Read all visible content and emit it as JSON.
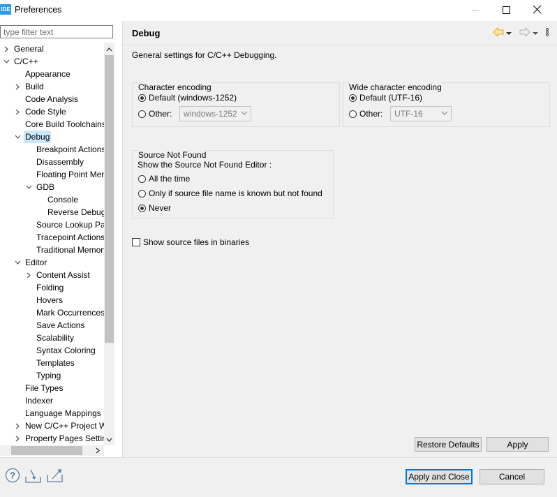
{
  "window": {
    "app_icon": "IDE",
    "title": "Preferences"
  },
  "filter": {
    "placeholder": "type filter text"
  },
  "tree": [
    {
      "label": "General",
      "level": 0,
      "chevron": "right",
      "selected": false
    },
    {
      "label": "C/C++",
      "level": 0,
      "chevron": "down",
      "selected": false
    },
    {
      "label": "Appearance",
      "level": 1,
      "chevron": "none",
      "selected": false
    },
    {
      "label": "Build",
      "level": 1,
      "chevron": "right",
      "selected": false
    },
    {
      "label": "Code Analysis",
      "level": 1,
      "chevron": "none",
      "selected": false
    },
    {
      "label": "Code Style",
      "level": 1,
      "chevron": "right",
      "selected": false
    },
    {
      "label": "Core Build Toolchains",
      "level": 1,
      "chevron": "none",
      "selected": false
    },
    {
      "label": "Debug",
      "level": 1,
      "chevron": "down",
      "selected": true
    },
    {
      "label": "Breakpoint Actions",
      "level": 2,
      "chevron": "none",
      "selected": false
    },
    {
      "label": "Disassembly",
      "level": 2,
      "chevron": "none",
      "selected": false
    },
    {
      "label": "Floating Point Memory",
      "level": 2,
      "chevron": "none",
      "selected": false
    },
    {
      "label": "GDB",
      "level": 2,
      "chevron": "down",
      "selected": false
    },
    {
      "label": "Console",
      "level": 3,
      "chevron": "none",
      "selected": false
    },
    {
      "label": "Reverse Debugging",
      "level": 3,
      "chevron": "none",
      "selected": false
    },
    {
      "label": "Source Lookup Path",
      "level": 2,
      "chevron": "none",
      "selected": false
    },
    {
      "label": "Tracepoint Actions",
      "level": 2,
      "chevron": "none",
      "selected": false
    },
    {
      "label": "Traditional Memory",
      "level": 2,
      "chevron": "none",
      "selected": false
    },
    {
      "label": "Editor",
      "level": 1,
      "chevron": "down",
      "selected": false
    },
    {
      "label": "Content Assist",
      "level": 2,
      "chevron": "right",
      "selected": false
    },
    {
      "label": "Folding",
      "level": 2,
      "chevron": "none",
      "selected": false
    },
    {
      "label": "Hovers",
      "level": 2,
      "chevron": "none",
      "selected": false
    },
    {
      "label": "Mark Occurrences",
      "level": 2,
      "chevron": "none",
      "selected": false
    },
    {
      "label": "Save Actions",
      "level": 2,
      "chevron": "none",
      "selected": false
    },
    {
      "label": "Scalability",
      "level": 2,
      "chevron": "none",
      "selected": false
    },
    {
      "label": "Syntax Coloring",
      "level": 2,
      "chevron": "none",
      "selected": false
    },
    {
      "label": "Templates",
      "level": 2,
      "chevron": "none",
      "selected": false
    },
    {
      "label": "Typing",
      "level": 2,
      "chevron": "none",
      "selected": false
    },
    {
      "label": "File Types",
      "level": 1,
      "chevron": "none",
      "selected": false
    },
    {
      "label": "Indexer",
      "level": 1,
      "chevron": "none",
      "selected": false
    },
    {
      "label": "Language Mappings",
      "level": 1,
      "chevron": "none",
      "selected": false
    },
    {
      "label": "New C/C++ Project Wizard",
      "level": 1,
      "chevron": "right",
      "selected": false
    },
    {
      "label": "Property Pages Settings",
      "level": 1,
      "chevron": "right",
      "selected": false
    }
  ],
  "page": {
    "title": "Debug",
    "description": "General settings for C/C++ Debugging.",
    "char_encoding": {
      "label": "Character encoding",
      "default_label": "Default (windows-1252)",
      "other_label": "Other:",
      "other_value": "windows-1252",
      "selected": "default"
    },
    "wide_encoding": {
      "label": "Wide character encoding",
      "default_label": "Default (UTF-16)",
      "other_label": "Other:",
      "other_value": "UTF-16",
      "selected": "default"
    },
    "source_not_found": {
      "label": "Source Not Found",
      "prompt": "Show the Source Not Found Editor :",
      "options": [
        "All the time",
        "Only if source file name is known but not found",
        "Never"
      ],
      "selected_index": 2
    },
    "show_source_files": {
      "label": "Show source files in binaries",
      "checked": false
    },
    "restore_defaults": "Restore Defaults",
    "apply": "Apply"
  },
  "footer": {
    "apply_close": "Apply and Close",
    "cancel": "Cancel"
  },
  "icons": {
    "help": "help-icon",
    "import": "import-icon",
    "export": "export-icon",
    "back": "back-arrow-icon",
    "forward": "forward-arrow-icon",
    "menu": "view-menu-icon"
  },
  "colors": {
    "selection": "#cce8ff",
    "back_arrow": "#e6a817",
    "default_button_border": "#0078d7",
    "app_icon_bg": "#2f9be8"
  }
}
